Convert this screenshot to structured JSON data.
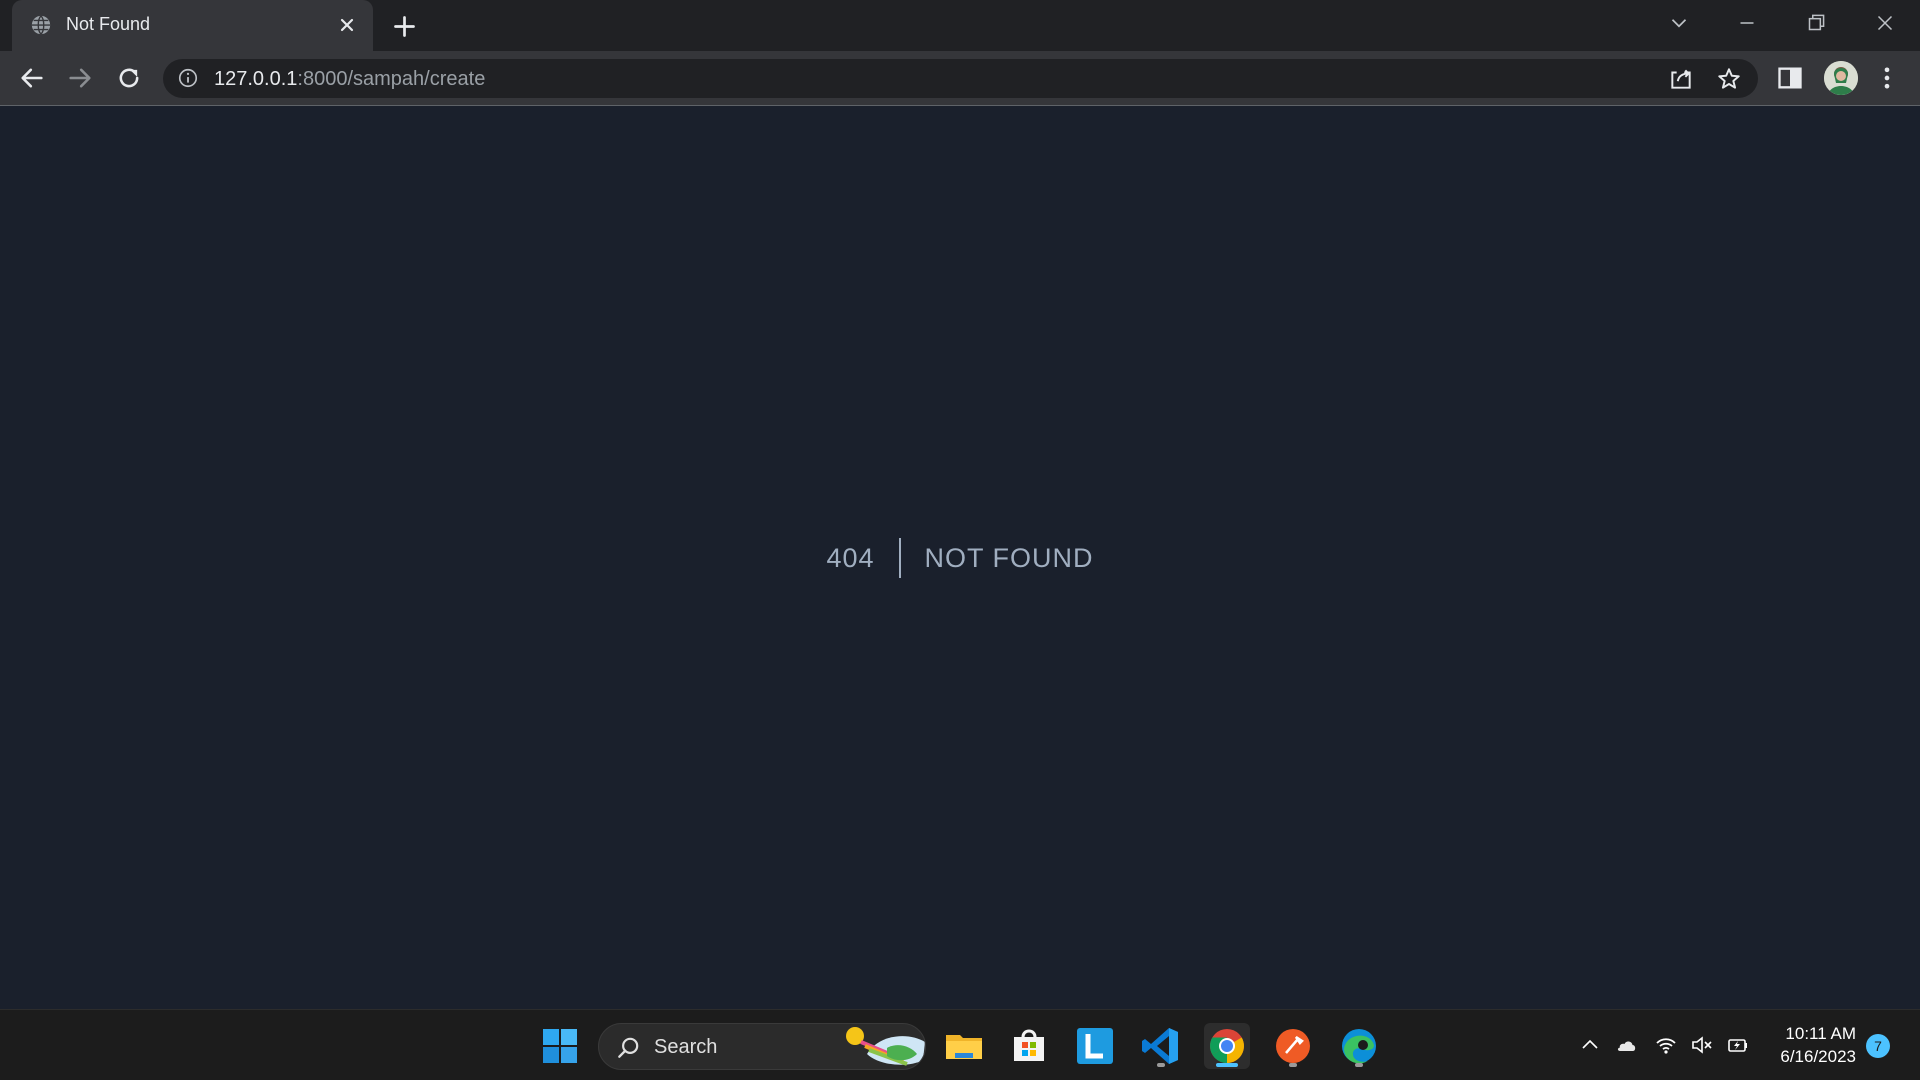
{
  "browser": {
    "tab": {
      "title": "Not Found",
      "favicon": "globe-icon"
    },
    "url": {
      "host": "127.0.0.1",
      "rest": ":8000/sampah/create"
    }
  },
  "page": {
    "code": "404",
    "message": "NOT FOUND",
    "background": "#1a202c",
    "text_color": "#a0aec0"
  },
  "taskbar": {
    "search_label": "Search",
    "apps": [
      {
        "name": "start"
      },
      {
        "name": "file-explorer"
      },
      {
        "name": "microsoft-store"
      },
      {
        "name": "l-app"
      },
      {
        "name": "vscode",
        "running": true
      },
      {
        "name": "chrome",
        "active": true
      },
      {
        "name": "postman",
        "running": true
      },
      {
        "name": "edge",
        "running": true
      }
    ],
    "clock": {
      "time": "10:11 AM",
      "date": "6/16/2023"
    },
    "notification_count": "7"
  }
}
